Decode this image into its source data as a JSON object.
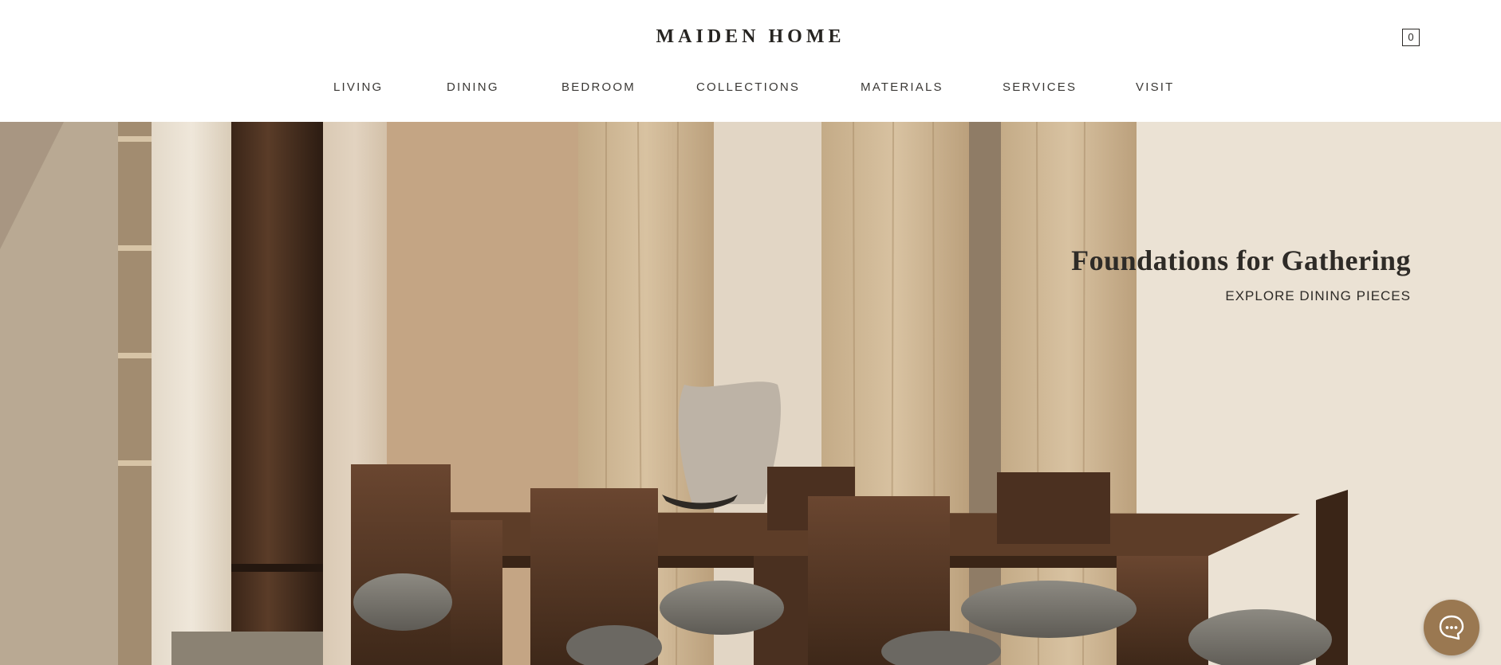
{
  "brand": {
    "logo_text": "MAIDEN HOME"
  },
  "cart": {
    "count": "0",
    "icon": "cart-box-icon"
  },
  "nav": {
    "items": [
      {
        "label": "LIVING"
      },
      {
        "label": "DINING"
      },
      {
        "label": "BEDROOM"
      },
      {
        "label": "COLLECTIONS"
      },
      {
        "label": "MATERIALS"
      },
      {
        "label": "SERVICES"
      },
      {
        "label": "VISIT"
      }
    ]
  },
  "hero": {
    "title": "Foundations for Gathering",
    "cta_label": "EXPLORE DINING PIECES",
    "image_subject": "dining-room-photo"
  },
  "chat": {
    "icon": "chat-bubble-icon",
    "accent_color": "#9a7851"
  },
  "colors": {
    "text": "#2b2926",
    "background": "#ffffff"
  }
}
